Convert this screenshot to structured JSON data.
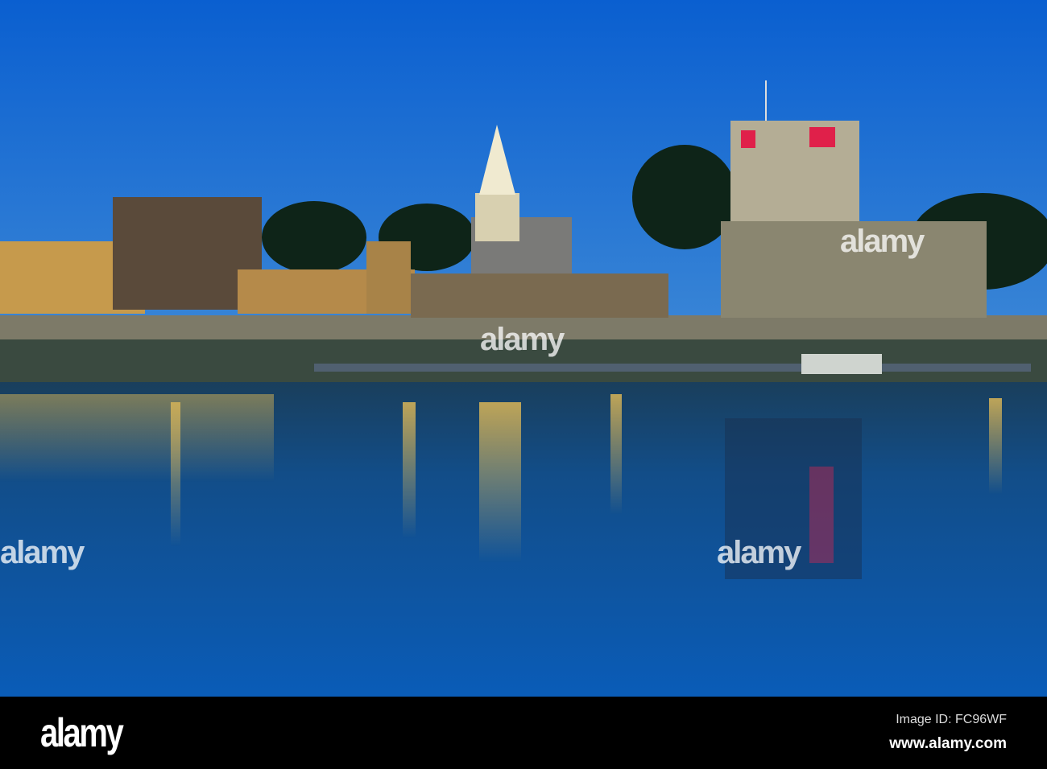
{
  "photo": {
    "subject": "Castle keep and cathedral spire floodlit at dusk, reflected in a river",
    "colors": {
      "sky_top": "#0a5fd0",
      "sky_bottom": "#2f7fd8",
      "water": "#0f4f9a",
      "light": "#ffc84a",
      "castle_red": "#e0204a"
    }
  },
  "watermark": {
    "text": "alamy"
  },
  "footer": {
    "logo": "alamy",
    "image_id": "Image ID: FC96WF",
    "website": "www.alamy.com"
  }
}
